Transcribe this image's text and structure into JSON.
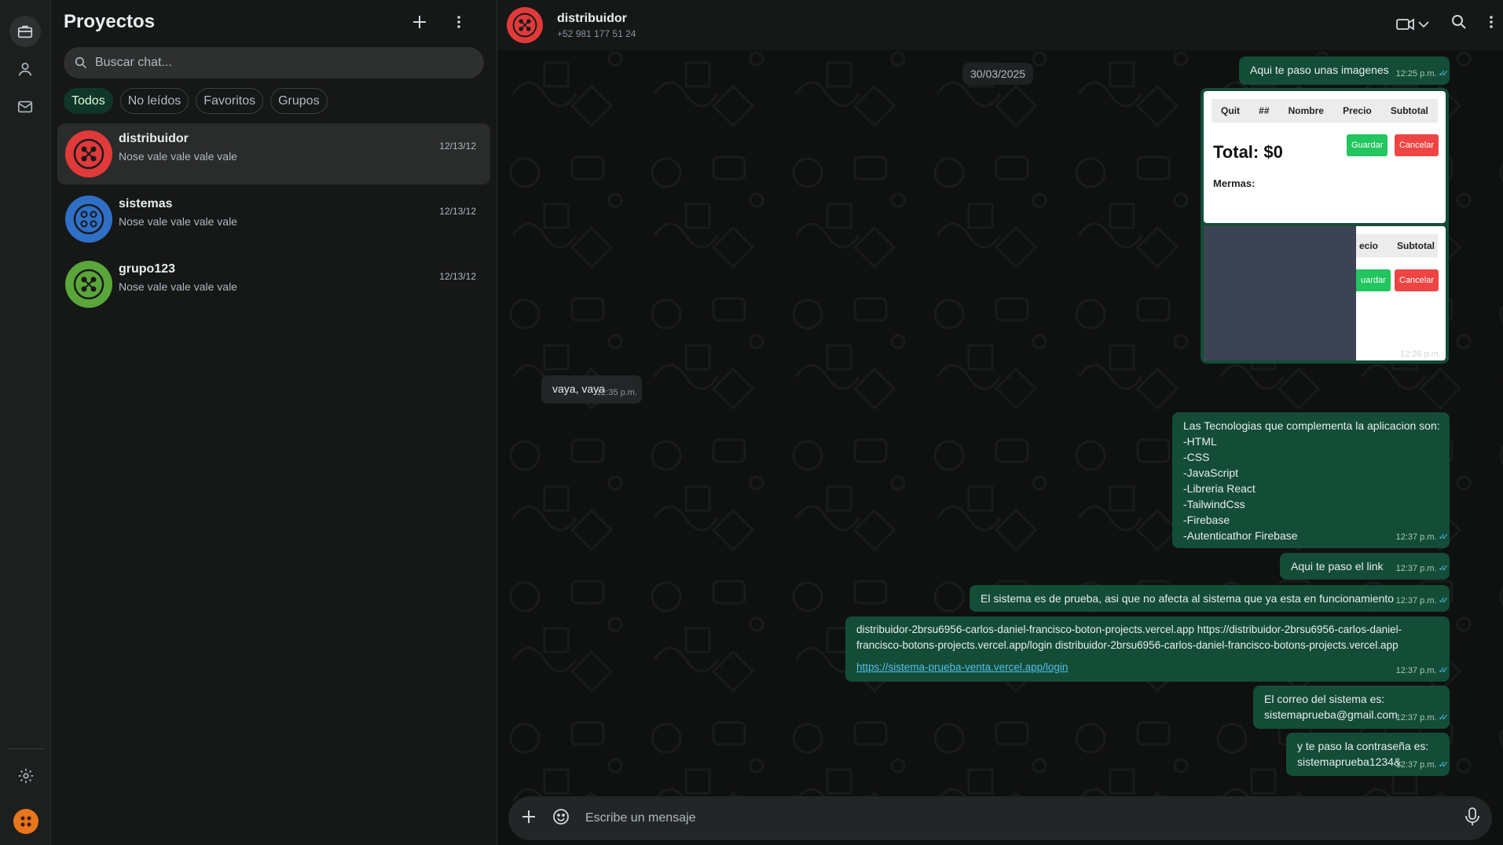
{
  "sidebar": {
    "title": "Proyectos",
    "search_placeholder": "Buscar chat...",
    "filters": [
      "Todos",
      "No leídos",
      "Favoritos",
      "Grupos"
    ],
    "chats": [
      {
        "name": "distribuidor",
        "preview": "Nose vale vale vale vale",
        "date": "12/13/12",
        "color": "#e03a3a"
      },
      {
        "name": "sistemas",
        "preview": "Nose vale vale vale vale",
        "date": "12/13/12",
        "color": "#2f6fc6"
      },
      {
        "name": "grupo123",
        "preview": "Nose vale vale vale vale",
        "date": "12/13/12",
        "color": "#5aa63a"
      }
    ]
  },
  "header": {
    "name": "distribuidor",
    "phone": "+52 981 177 51 24"
  },
  "conversation": {
    "date": "30/03/2025",
    "m1": {
      "text": "Aqui te paso unas imagenes",
      "time": "12:25 p.m."
    },
    "card": {
      "columns": [
        "Quit",
        "##",
        "Nombre",
        "Precio",
        "Subtotal"
      ],
      "columns2": [
        "ecio",
        "Subtotal"
      ],
      "total": "Total: $0",
      "mermas": "Mermas:",
      "save": "Guardar",
      "save2": "uardar",
      "cancel": "Cancelar",
      "time": "12:26 p.m."
    },
    "m2": {
      "text": "vaya, vaya",
      "time": "12:35 p.m."
    },
    "m3": {
      "lines": [
        "Las Tecnologias que complementa la aplicacion son:",
        "-HTML",
        "-CSS",
        "-JavaScript",
        "-Libreria React",
        "-TailwindCss",
        "-Firebase",
        "-Autenticathor Firebase"
      ],
      "time": "12:37 p.m."
    },
    "m4": {
      "text": "Aqui te paso el link",
      "time": "12:37 p.m."
    },
    "m5": {
      "text": "El sistema es de prueba, asi que no afecta al sistema que ya esta en funcionamiento",
      "time": "12:37 p.m."
    },
    "m6": {
      "line1": "distribuidor-2brsu6956-carlos-daniel-francisco-boton-projects.vercel.app https://distribuidor-2brsu6956-carlos-daniel-",
      "line2": "francisco-botons-projects.vercel.app/login distribuidor-2brsu6956-carlos-daniel-francisco-botons-projects.vercel.app",
      "link": "https://sistema-prueba-venta.vercel.app/login",
      "time": "12:37 p.m."
    },
    "m7": {
      "line1": "El correo del sistema es:",
      "line2": "sistemaprueba@gmail.com",
      "time": "12:37 p.m."
    },
    "m8": {
      "line1": "y te paso la contraseña es:",
      "line2": "sistemaprueba1234&",
      "time": "12:37 p.m."
    }
  },
  "composer": {
    "placeholder": "Escribe un mensaje"
  },
  "colors": {
    "accent": "#25d366",
    "outgoing": "#144d37",
    "incoming": "#232626",
    "link": "#53bdeb"
  }
}
